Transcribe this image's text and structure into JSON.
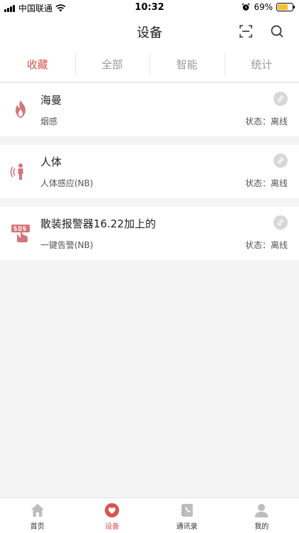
{
  "status_bar": {
    "carrier": "中国联通",
    "time": "10:32",
    "battery": "69%",
    "battery_level": 0.69
  },
  "header": {
    "title": "设备",
    "scan_icon": "scan-icon",
    "search_icon": "search-icon"
  },
  "tabs": [
    {
      "label": "收藏",
      "active": true
    },
    {
      "label": "全部",
      "active": false
    },
    {
      "label": "智能",
      "active": false
    },
    {
      "label": "统计",
      "active": false
    }
  ],
  "devices": [
    {
      "name": "海曼",
      "type": "烟感",
      "status": "状态：离线",
      "icon": "fire-icon"
    },
    {
      "name": "人体",
      "type": "人体感应(NB)",
      "status": "状态：离线",
      "icon": "person-sensor-icon"
    },
    {
      "name": "散装报警器16.22加上的",
      "type": "一键告警(NB)",
      "status": "状态：离线",
      "icon": "sos-button-icon"
    }
  ],
  "bottom_nav": [
    {
      "label": "首页",
      "icon": "home-icon",
      "active": false
    },
    {
      "label": "设备",
      "icon": "heart-icon",
      "active": true
    },
    {
      "label": "通讯录",
      "icon": "contacts-icon",
      "active": false
    },
    {
      "label": "我的",
      "icon": "profile-icon",
      "active": false
    }
  ],
  "colors": {
    "accent": "#d9534f",
    "device_icon": "#d4757a",
    "inactive_tab": "#999999",
    "background": "#f4f4f4"
  }
}
